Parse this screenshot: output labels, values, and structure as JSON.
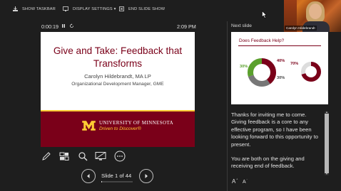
{
  "toolbar": {
    "show_taskbar": "SHOW TASKBAR",
    "display_settings": "DISPLAY SETTINGS ▾",
    "end_slide_show": "END SLIDE SHOW"
  },
  "presenter": {
    "name": "Carolyn Hildebrandt"
  },
  "timer": {
    "elapsed": "0:00:19",
    "clock": "2:09 PM"
  },
  "current_slide": {
    "title": "Give and Take: Feedback that Transforms",
    "presenter_line": "Carolyn Hildebrandt, MA LP",
    "role_line": "Organizational Development Manager, GME",
    "university": "UNIVERSITY OF MINNESOTA",
    "tagline": "Driven to Discover®"
  },
  "navigation": {
    "slide_counter": "Slide 1 of 44",
    "progress_fraction": 0.023
  },
  "next_slide": {
    "label": "Next slide",
    "title": "Does Feedback Help?",
    "stat_40": "40%",
    "stat_30a": "30%",
    "stat_30b": "30%",
    "stat_70": "70%"
  },
  "notes": {
    "paragraph1": "Thanks for inviting me to come. Giving feedback is a core to any effective program, so I have been looking forward to this opportunity to present.",
    "paragraph2": "You are both on the giving and receiving end of feedback."
  },
  "colors": {
    "umn_maroon": "#7a0019",
    "umn_gold": "#ffcc33",
    "background": "#1e1e1e"
  }
}
